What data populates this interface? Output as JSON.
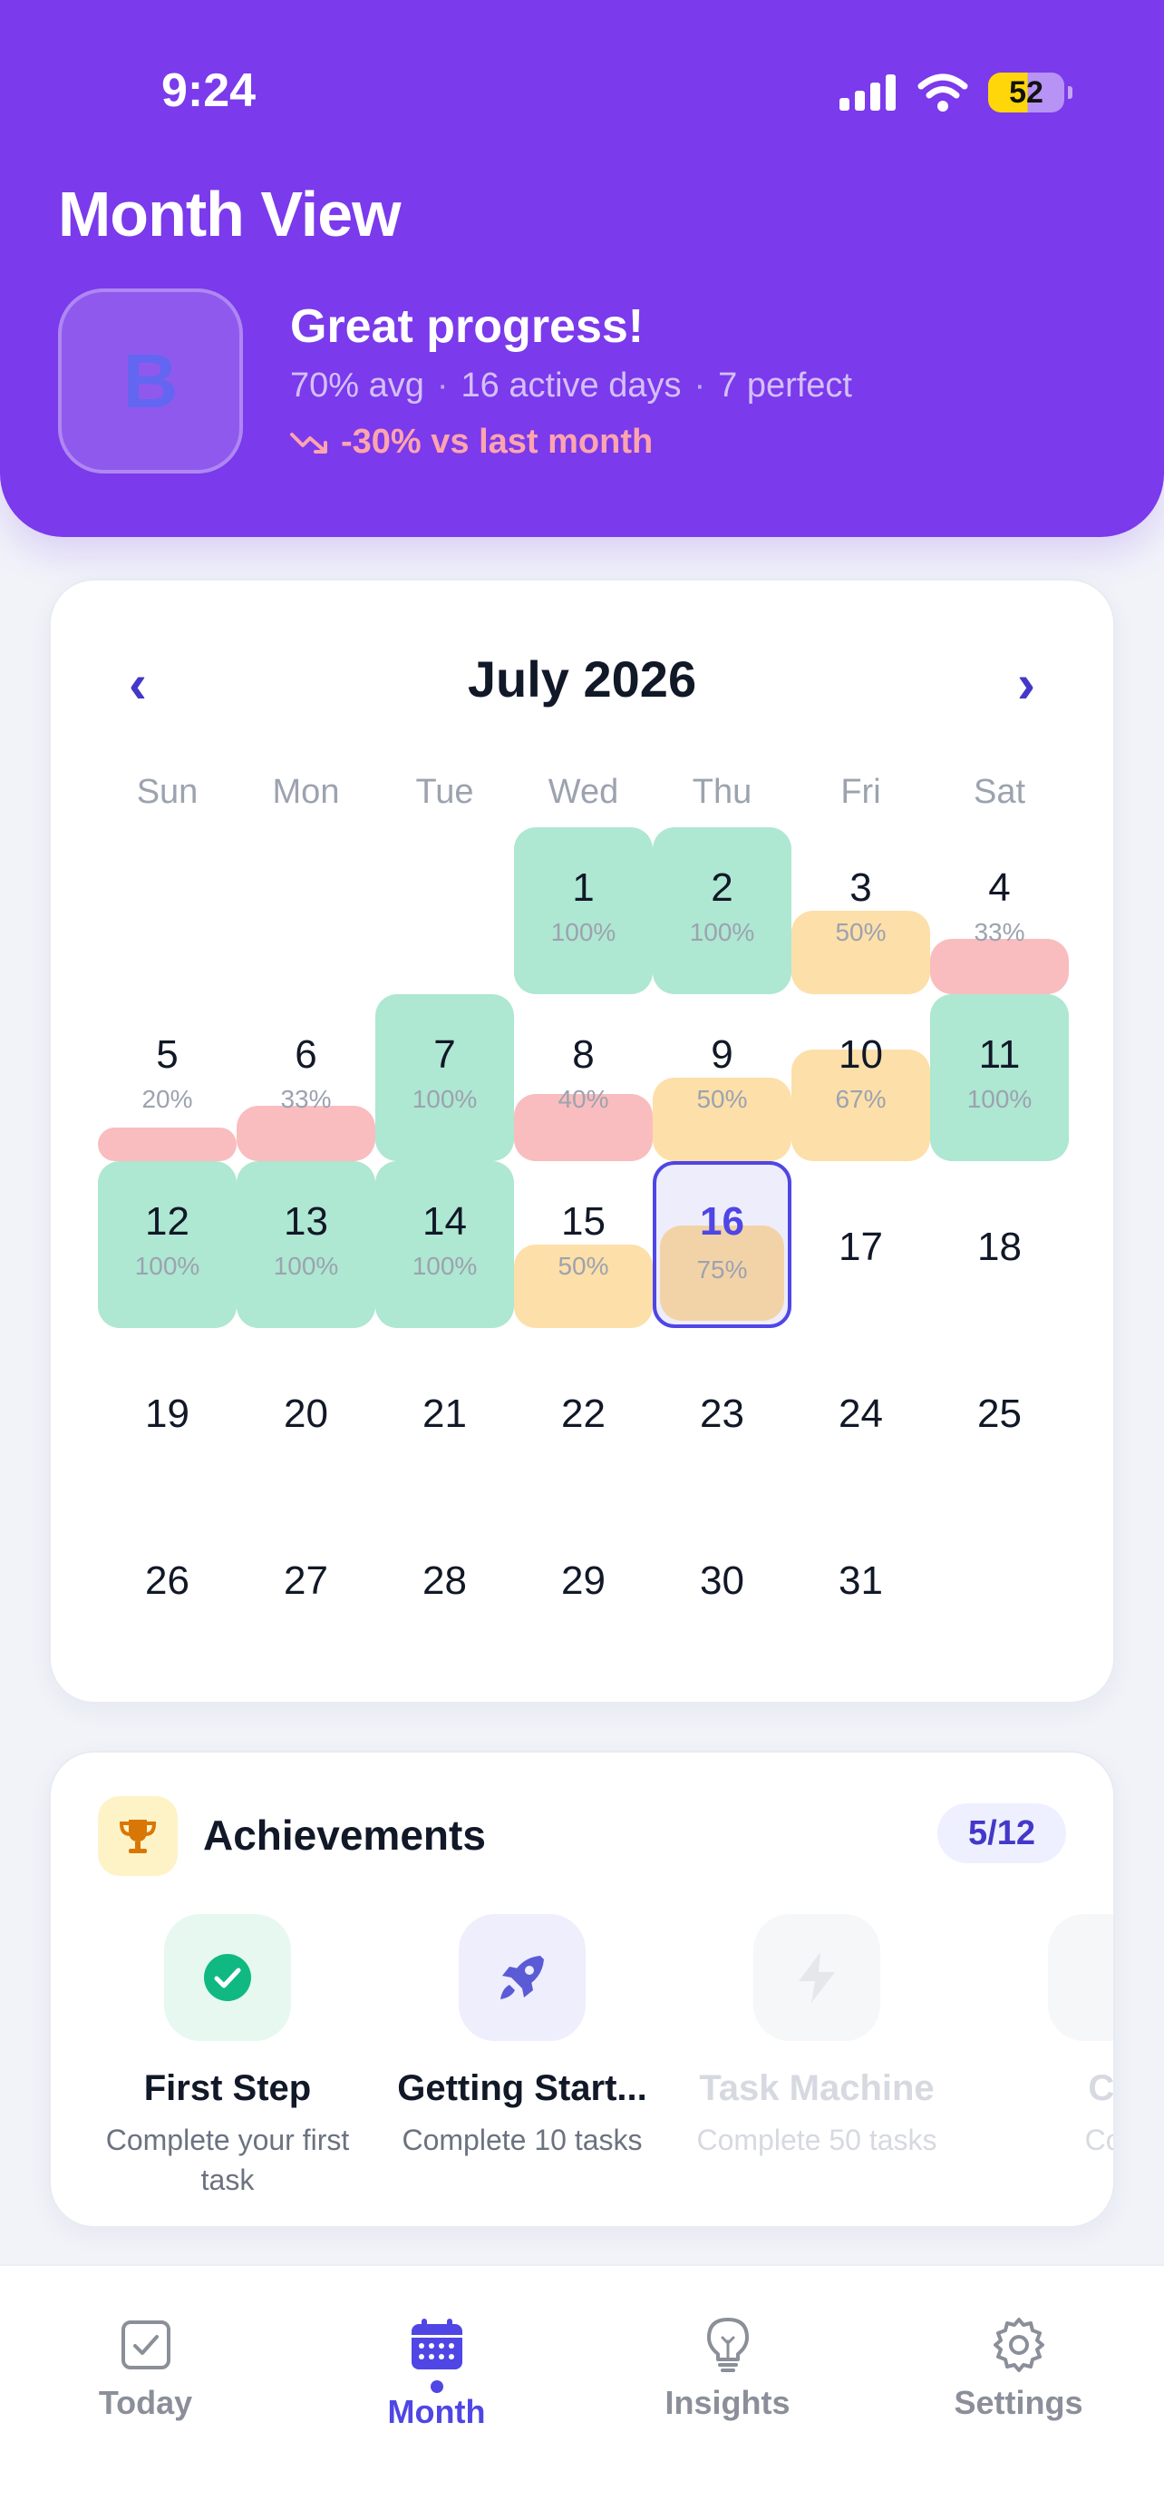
{
  "status_bar": {
    "time": "9:24",
    "battery": "52"
  },
  "header": {
    "title": "Month View",
    "avatar_letter": "B",
    "progress_title": "Great progress!",
    "stats": [
      "70% avg",
      "16 active days",
      "7 perfect"
    ],
    "separator": "·",
    "trend": "-30% vs last month"
  },
  "calendar": {
    "month_label": "July 2026",
    "prev_symbol": "‹",
    "next_symbol": "›",
    "weekdays": [
      "Sun",
      "Mon",
      "Tue",
      "Wed",
      "Thu",
      "Fri",
      "Sat"
    ],
    "first_weekday_index": 3,
    "today": 16,
    "days": [
      {
        "day": "1",
        "pct": "100%",
        "value": 100
      },
      {
        "day": "2",
        "pct": "100%",
        "value": 100
      },
      {
        "day": "3",
        "pct": "50%",
        "value": 50
      },
      {
        "day": "4",
        "pct": "33%",
        "value": 33
      },
      {
        "day": "5",
        "pct": "20%",
        "value": 20
      },
      {
        "day": "6",
        "pct": "33%",
        "value": 33
      },
      {
        "day": "7",
        "pct": "100%",
        "value": 100
      },
      {
        "day": "8",
        "pct": "40%",
        "value": 40
      },
      {
        "day": "9",
        "pct": "50%",
        "value": 50
      },
      {
        "day": "10",
        "pct": "67%",
        "value": 67
      },
      {
        "day": "11",
        "pct": "100%",
        "value": 100
      },
      {
        "day": "12",
        "pct": "100%",
        "value": 100
      },
      {
        "day": "13",
        "pct": "100%",
        "value": 100
      },
      {
        "day": "14",
        "pct": "100%",
        "value": 100
      },
      {
        "day": "15",
        "pct": "50%",
        "value": 50
      },
      {
        "day": "16",
        "pct": "75%",
        "value": 75
      },
      {
        "day": "17"
      },
      {
        "day": "18"
      },
      {
        "day": "19"
      },
      {
        "day": "20"
      },
      {
        "day": "21"
      },
      {
        "day": "22"
      },
      {
        "day": "23"
      },
      {
        "day": "24"
      },
      {
        "day": "25"
      },
      {
        "day": "26"
      },
      {
        "day": "27"
      },
      {
        "day": "28"
      },
      {
        "day": "29"
      },
      {
        "day": "30"
      },
      {
        "day": "31"
      }
    ],
    "colors": {
      "full": "#AEE7D2",
      "mid": "#FDDFA9",
      "low": "#F9BDBF",
      "today_fill": "#F2D3A8"
    }
  },
  "achievements": {
    "title": "Achievements",
    "count": "5/12",
    "badges": [
      {
        "name": "First Step",
        "desc": "Complete your first task",
        "icon": "check-circle-icon",
        "locked": false,
        "bg": "#E6F8F0"
      },
      {
        "name": "Getting Start...",
        "desc": "Complete 10 tasks",
        "icon": "rocket-icon",
        "locked": false,
        "bg": "#EEEEFD"
      },
      {
        "name": "Task Machine",
        "desc": "Complete 50 tasks",
        "icon": "lightning-icon",
        "locked": true,
        "bg": "#F6F7F9"
      },
      {
        "name": "Ce",
        "desc": "Con",
        "icon": "locked-badge-icon",
        "locked": true,
        "bg": "#F6F7F9"
      }
    ]
  },
  "tabbar": {
    "tabs": [
      {
        "label": "Today",
        "icon": "checkbox-icon",
        "active": false
      },
      {
        "label": "Month",
        "icon": "calendar-icon",
        "active": true
      },
      {
        "label": "Insights",
        "icon": "lightbulb-icon",
        "active": false
      },
      {
        "label": "Settings",
        "icon": "gear-icon",
        "active": false
      }
    ]
  }
}
